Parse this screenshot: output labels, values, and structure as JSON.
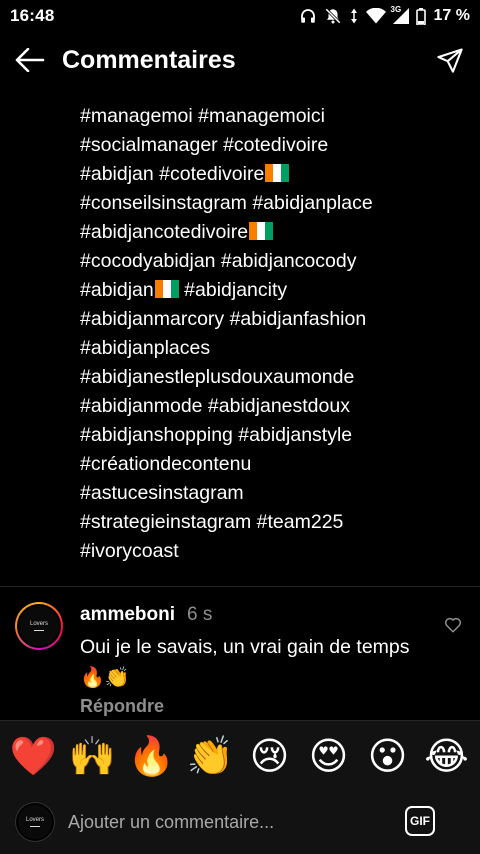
{
  "status_bar": {
    "time": "16:48",
    "network": "3G",
    "battery": "17 %"
  },
  "header": {
    "title": "Commentaires",
    "back_icon": "arrow-left-icon",
    "send_icon": "paper-plane-icon"
  },
  "caption": {
    "lines": [
      "#managemoi #managemoici",
      "#socialmanager #cotedivoire",
      "#abidjan #cotedivoire",
      "#conseilsinstagram #abidjanplace",
      "#abidjancotedivoire",
      "#cocodyabidjan #abidjancocody",
      "#abidjan",
      "#abidjancity",
      "#abidjanmarcory #abidjanfashion",
      "#abidjanplaces",
      "#abidjanestleplusdouxaumonde",
      "#abidjanmode #abidjanestdoux",
      "#abidjanshopping #abidjanstyle",
      "#créationdecontenu",
      "#astucesinstagram",
      "#strategieinstagram #team225",
      "#ivorycoast"
    ],
    "flag_icon": "ivory-coast-flag-icon"
  },
  "comment": {
    "avatar_text": "Lovers",
    "username": "ammeboni",
    "time": "6 s",
    "text": "Oui je le savais, un vrai gain de temps",
    "emojis": "🔥👏",
    "reply_label": "Répondre",
    "like_icon": "heart-outline-icon"
  },
  "emoji_bar": [
    {
      "name": "red-heart",
      "glyph": "❤️"
    },
    {
      "name": "raising-hands",
      "glyph": "🙌"
    },
    {
      "name": "fire",
      "glyph": "🔥"
    },
    {
      "name": "clapping-hands",
      "glyph": "👏"
    },
    {
      "name": "crying-face",
      "glyph": "😢"
    },
    {
      "name": "heart-eyes",
      "glyph": "😍"
    },
    {
      "name": "astonished-face",
      "glyph": "😮"
    },
    {
      "name": "tears-of-joy",
      "glyph": "😂"
    }
  ],
  "composer": {
    "avatar_text": "Lovers",
    "placeholder": "Ajouter un commentaire...",
    "gif_label": "GIF"
  },
  "colors": {
    "background": "#000000",
    "muted_text": "#8e8e8e",
    "bar_background": "#121212",
    "flag_orange": "#f77f00",
    "flag_white": "#ffffff",
    "flag_green": "#009e60"
  }
}
